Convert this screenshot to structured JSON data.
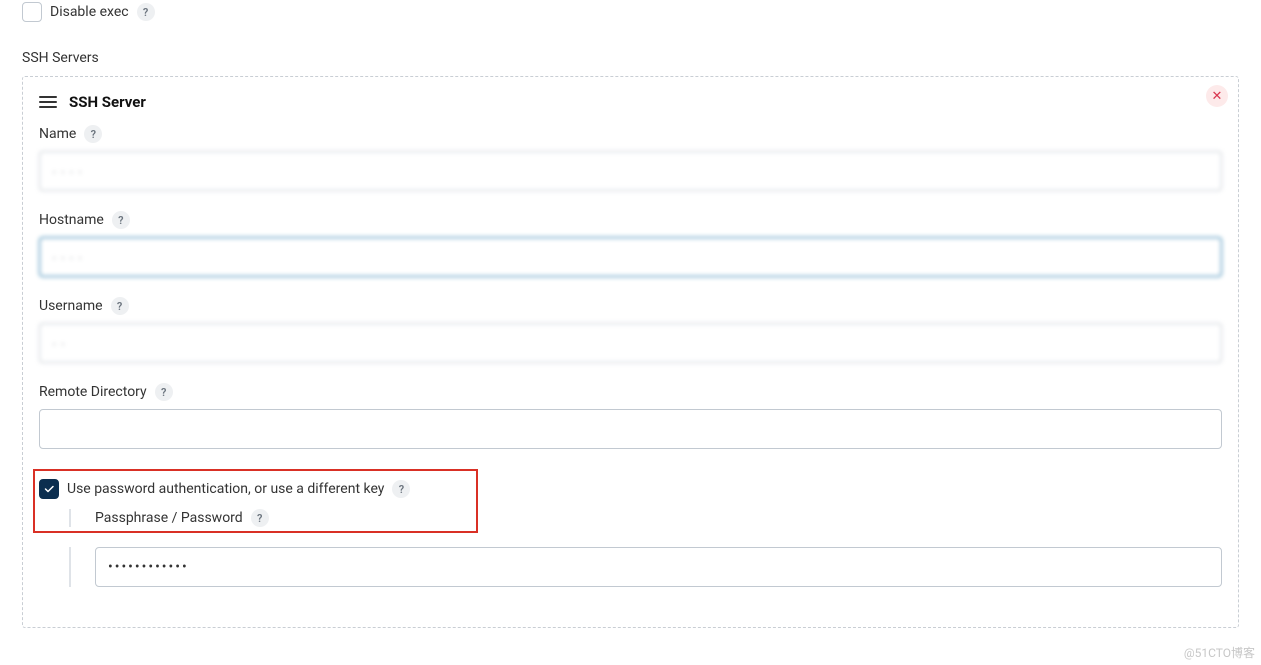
{
  "top": {
    "disable_exec_label": "Disable exec",
    "disable_exec_checked": false
  },
  "section_label": "SSH Servers",
  "panel": {
    "title": "SSH Server",
    "close_glyph": "✕",
    "fields": {
      "name": {
        "label": "Name",
        "value": "· · · ·"
      },
      "hostname": {
        "label": "Hostname",
        "value": "· · · ·"
      },
      "username": {
        "label": "Username",
        "value": "· ·"
      },
      "remote_directory": {
        "label": "Remote Directory",
        "value": ""
      },
      "use_password": {
        "label": "Use password authentication, or use a different key",
        "checked": true
      },
      "passphrase": {
        "label": "Passphrase / Password",
        "value": "••••••••••••"
      }
    }
  },
  "help_glyph": "?",
  "watermark": "@51CTO博客"
}
